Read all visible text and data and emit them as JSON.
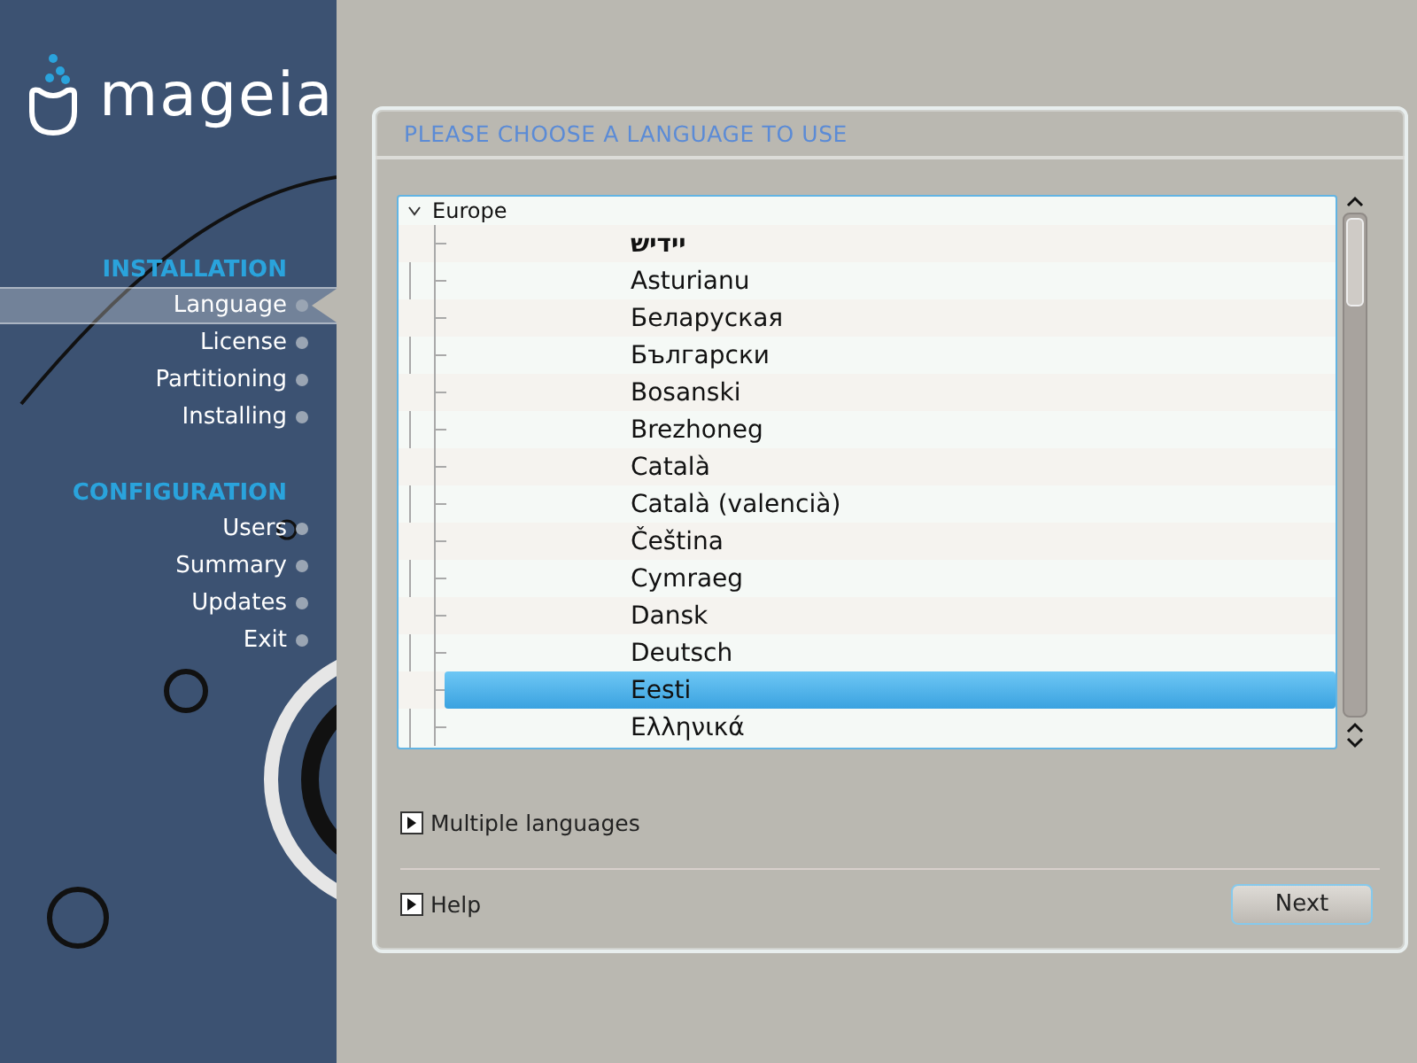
{
  "logo": {
    "text": "mageia"
  },
  "sidebar": {
    "sections": [
      {
        "title": "INSTALLATION",
        "items": [
          {
            "label": "Language",
            "selected": true
          },
          {
            "label": "License",
            "selected": false
          },
          {
            "label": "Partitioning",
            "selected": false
          },
          {
            "label": "Installing",
            "selected": false
          }
        ]
      },
      {
        "title": "CONFIGURATION",
        "items": [
          {
            "label": "Users",
            "selected": false
          },
          {
            "label": "Summary",
            "selected": false
          },
          {
            "label": "Updates",
            "selected": false
          },
          {
            "label": "Exit",
            "selected": false
          }
        ]
      }
    ]
  },
  "title": "PLEASE CHOOSE A LANGUAGE TO USE",
  "tree": {
    "group": "Europe",
    "expanded": true,
    "children": [
      {
        "label": "יידיש",
        "rtl": true,
        "selected": false
      },
      {
        "label": "Asturianu",
        "rtl": false,
        "selected": false
      },
      {
        "label": "Беларуская",
        "rtl": false,
        "selected": false
      },
      {
        "label": "Български",
        "rtl": false,
        "selected": false
      },
      {
        "label": "Bosanski",
        "rtl": false,
        "selected": false
      },
      {
        "label": "Brezhoneg",
        "rtl": false,
        "selected": false
      },
      {
        "label": "Català",
        "rtl": false,
        "selected": false
      },
      {
        "label": "Català (valencià)",
        "rtl": false,
        "selected": false
      },
      {
        "label": "Čeština",
        "rtl": false,
        "selected": false
      },
      {
        "label": "Cymraeg",
        "rtl": false,
        "selected": false
      },
      {
        "label": "Dansk",
        "rtl": false,
        "selected": false
      },
      {
        "label": "Deutsch",
        "rtl": false,
        "selected": false
      },
      {
        "label": "Eesti",
        "rtl": false,
        "selected": true
      },
      {
        "label": "Ελληνικά",
        "rtl": false,
        "selected": false
      }
    ]
  },
  "expanders": [
    {
      "label": "Multiple languages",
      "expanded": false
    }
  ],
  "help": {
    "label": "Help",
    "expanded": false
  },
  "buttons": [
    "Next"
  ]
}
